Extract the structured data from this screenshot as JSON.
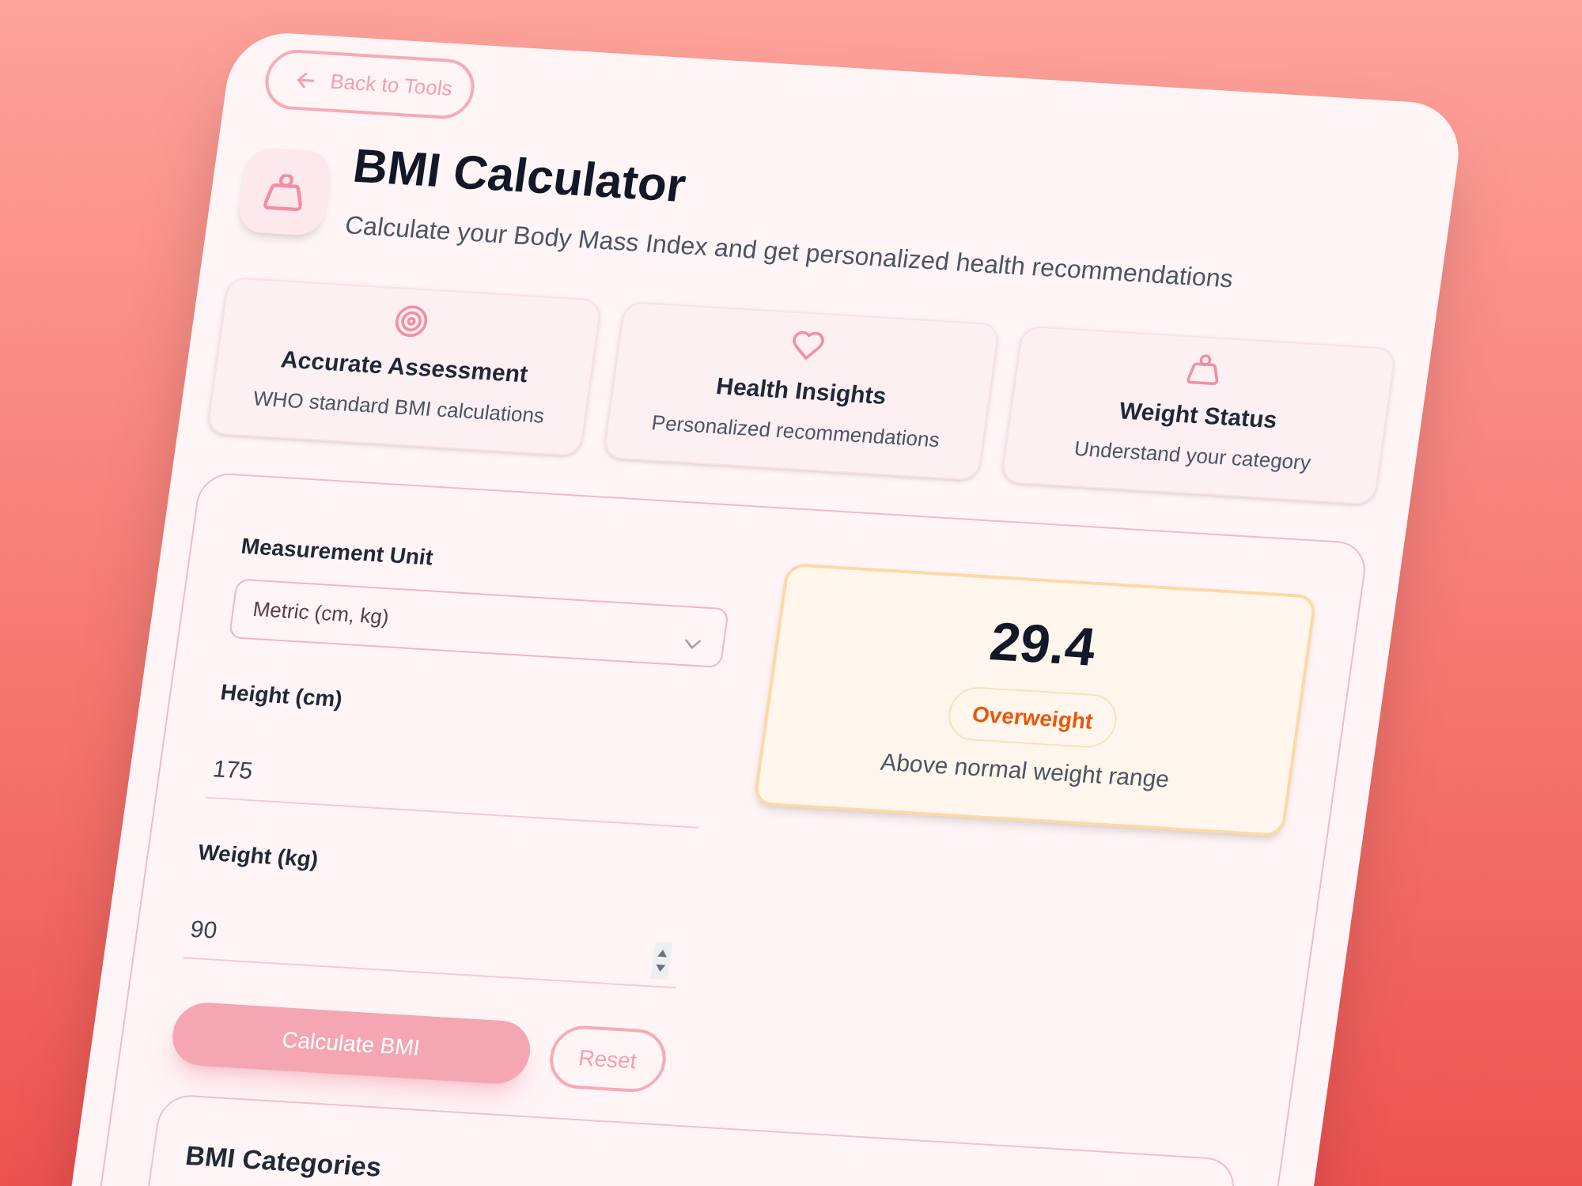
{
  "back_link": {
    "label": "Back to Tools"
  },
  "header": {
    "title": "BMI Calculator",
    "subtitle": "Calculate your Body Mass Index and get personalized health recommendations"
  },
  "features": [
    {
      "title": "Accurate Assessment",
      "description": "WHO standard BMI calculations"
    },
    {
      "title": "Health Insights",
      "description": "Personalized recommendations"
    },
    {
      "title": "Weight Status",
      "description": "Understand your category"
    }
  ],
  "form": {
    "unit": {
      "label": "Measurement Unit",
      "value": "Metric (cm, kg)"
    },
    "fields": [
      {
        "kind": "plain",
        "label": "Height (cm)",
        "value": "175"
      },
      {
        "kind": "stepper",
        "label": "Weight (kg)",
        "value": "90"
      }
    ],
    "buttons": [
      {
        "kind": "primary",
        "label": "Calculate BMI"
      },
      {
        "kind": "outline",
        "label": "Reset"
      }
    ]
  },
  "result": {
    "value": "29.4",
    "category": "Overweight",
    "description": "Above normal weight range"
  },
  "categories": {
    "title": "BMI Categories"
  }
}
